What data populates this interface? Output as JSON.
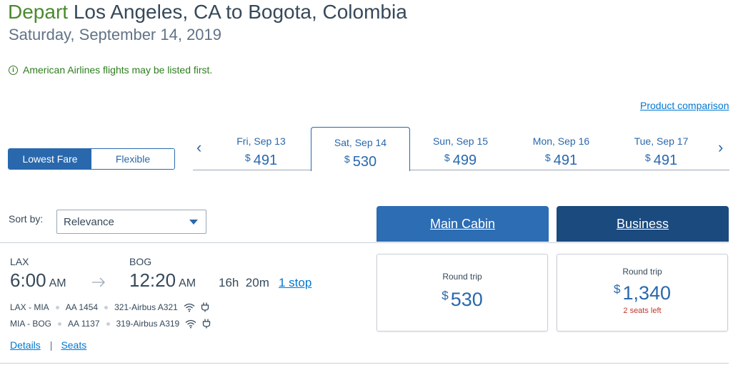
{
  "header": {
    "depart_word": "Depart",
    "route": "Los Angeles, CA to Bogota, Colombia",
    "date": "Saturday, September 14, 2019"
  },
  "notice": {
    "icon": "info-icon",
    "text": "American Airlines flights may be listed first."
  },
  "product_comparison_link": "Product comparison",
  "fare_toggle": {
    "options": [
      "Lowest Fare",
      "Flexible"
    ],
    "selected": "Lowest Fare"
  },
  "date_carousel": {
    "prev_icon": "chevron-left-icon",
    "next_icon": "chevron-right-icon",
    "currency": "$",
    "dates": [
      {
        "label": "Fri, Sep 13",
        "price": "491",
        "selected": false
      },
      {
        "label": "Sat, Sep 14",
        "price": "530",
        "selected": true
      },
      {
        "label": "Sun, Sep 15",
        "price": "499",
        "selected": false
      },
      {
        "label": "Mon, Sep 16",
        "price": "491",
        "selected": false
      },
      {
        "label": "Tue, Sep 17",
        "price": "491",
        "selected": false
      }
    ]
  },
  "sort": {
    "label": "Sort by:",
    "value": "Relevance"
  },
  "cabins": {
    "main": "Main Cabin",
    "business": "Business"
  },
  "flight": {
    "origin": "LAX",
    "destination": "BOG",
    "depart_time": "6:00",
    "depart_ampm": "AM",
    "arrive_time": "12:20",
    "arrive_ampm": "AM",
    "duration": "16h  20m",
    "stops": "1 stop",
    "segments": [
      {
        "route": "LAX - MIA",
        "flight": "AA 1454",
        "aircraft": "321-Airbus A321"
      },
      {
        "route": "MIA - BOG",
        "flight": "AA 1137",
        "aircraft": "319-Airbus A319"
      }
    ],
    "details_link": "Details",
    "separator": "|",
    "seats_link": "Seats"
  },
  "fares": {
    "main": {
      "label": "Round trip",
      "currency": "$",
      "price": "530"
    },
    "business": {
      "label": "Round trip",
      "currency": "$",
      "price": "1,340",
      "seats_left": "2 seats left"
    }
  },
  "colors": {
    "brand_blue": "#2968ad",
    "dark_blue": "#1b4a7e",
    "link_blue": "#0078d2",
    "green": "#2f7d1f",
    "alert_red": "#c0392b"
  }
}
